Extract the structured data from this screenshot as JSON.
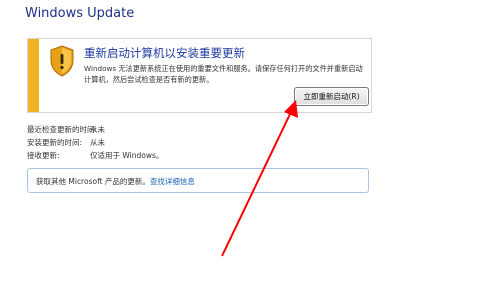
{
  "window": {
    "title": "Windows Update"
  },
  "alert": {
    "title": "重新启动计算机以安装重要更新",
    "description": "Windows 无法更新系统正在使用的重要文件和服务。请保存任何打开的文件并重新启动计算机，然后尝试检查是否有新的更新。",
    "restart_button_label": "立即重新启动(R)",
    "icon": "shield-warning-icon",
    "accent_color": "#f2b320"
  },
  "info": [
    {
      "label": "最近检查更新的时间:",
      "value": "从未"
    },
    {
      "label": "安装更新的时间:",
      "value": "从未"
    },
    {
      "label": "接收更新:",
      "value": "仅适用于 Windows。"
    }
  ],
  "other_products": {
    "text": "获取其他 Microsoft 产品的更新。",
    "link_label": "查找详细信息"
  },
  "annotation": {
    "arrow_color": "#ff0000",
    "icon": "red-arrow-icon"
  }
}
